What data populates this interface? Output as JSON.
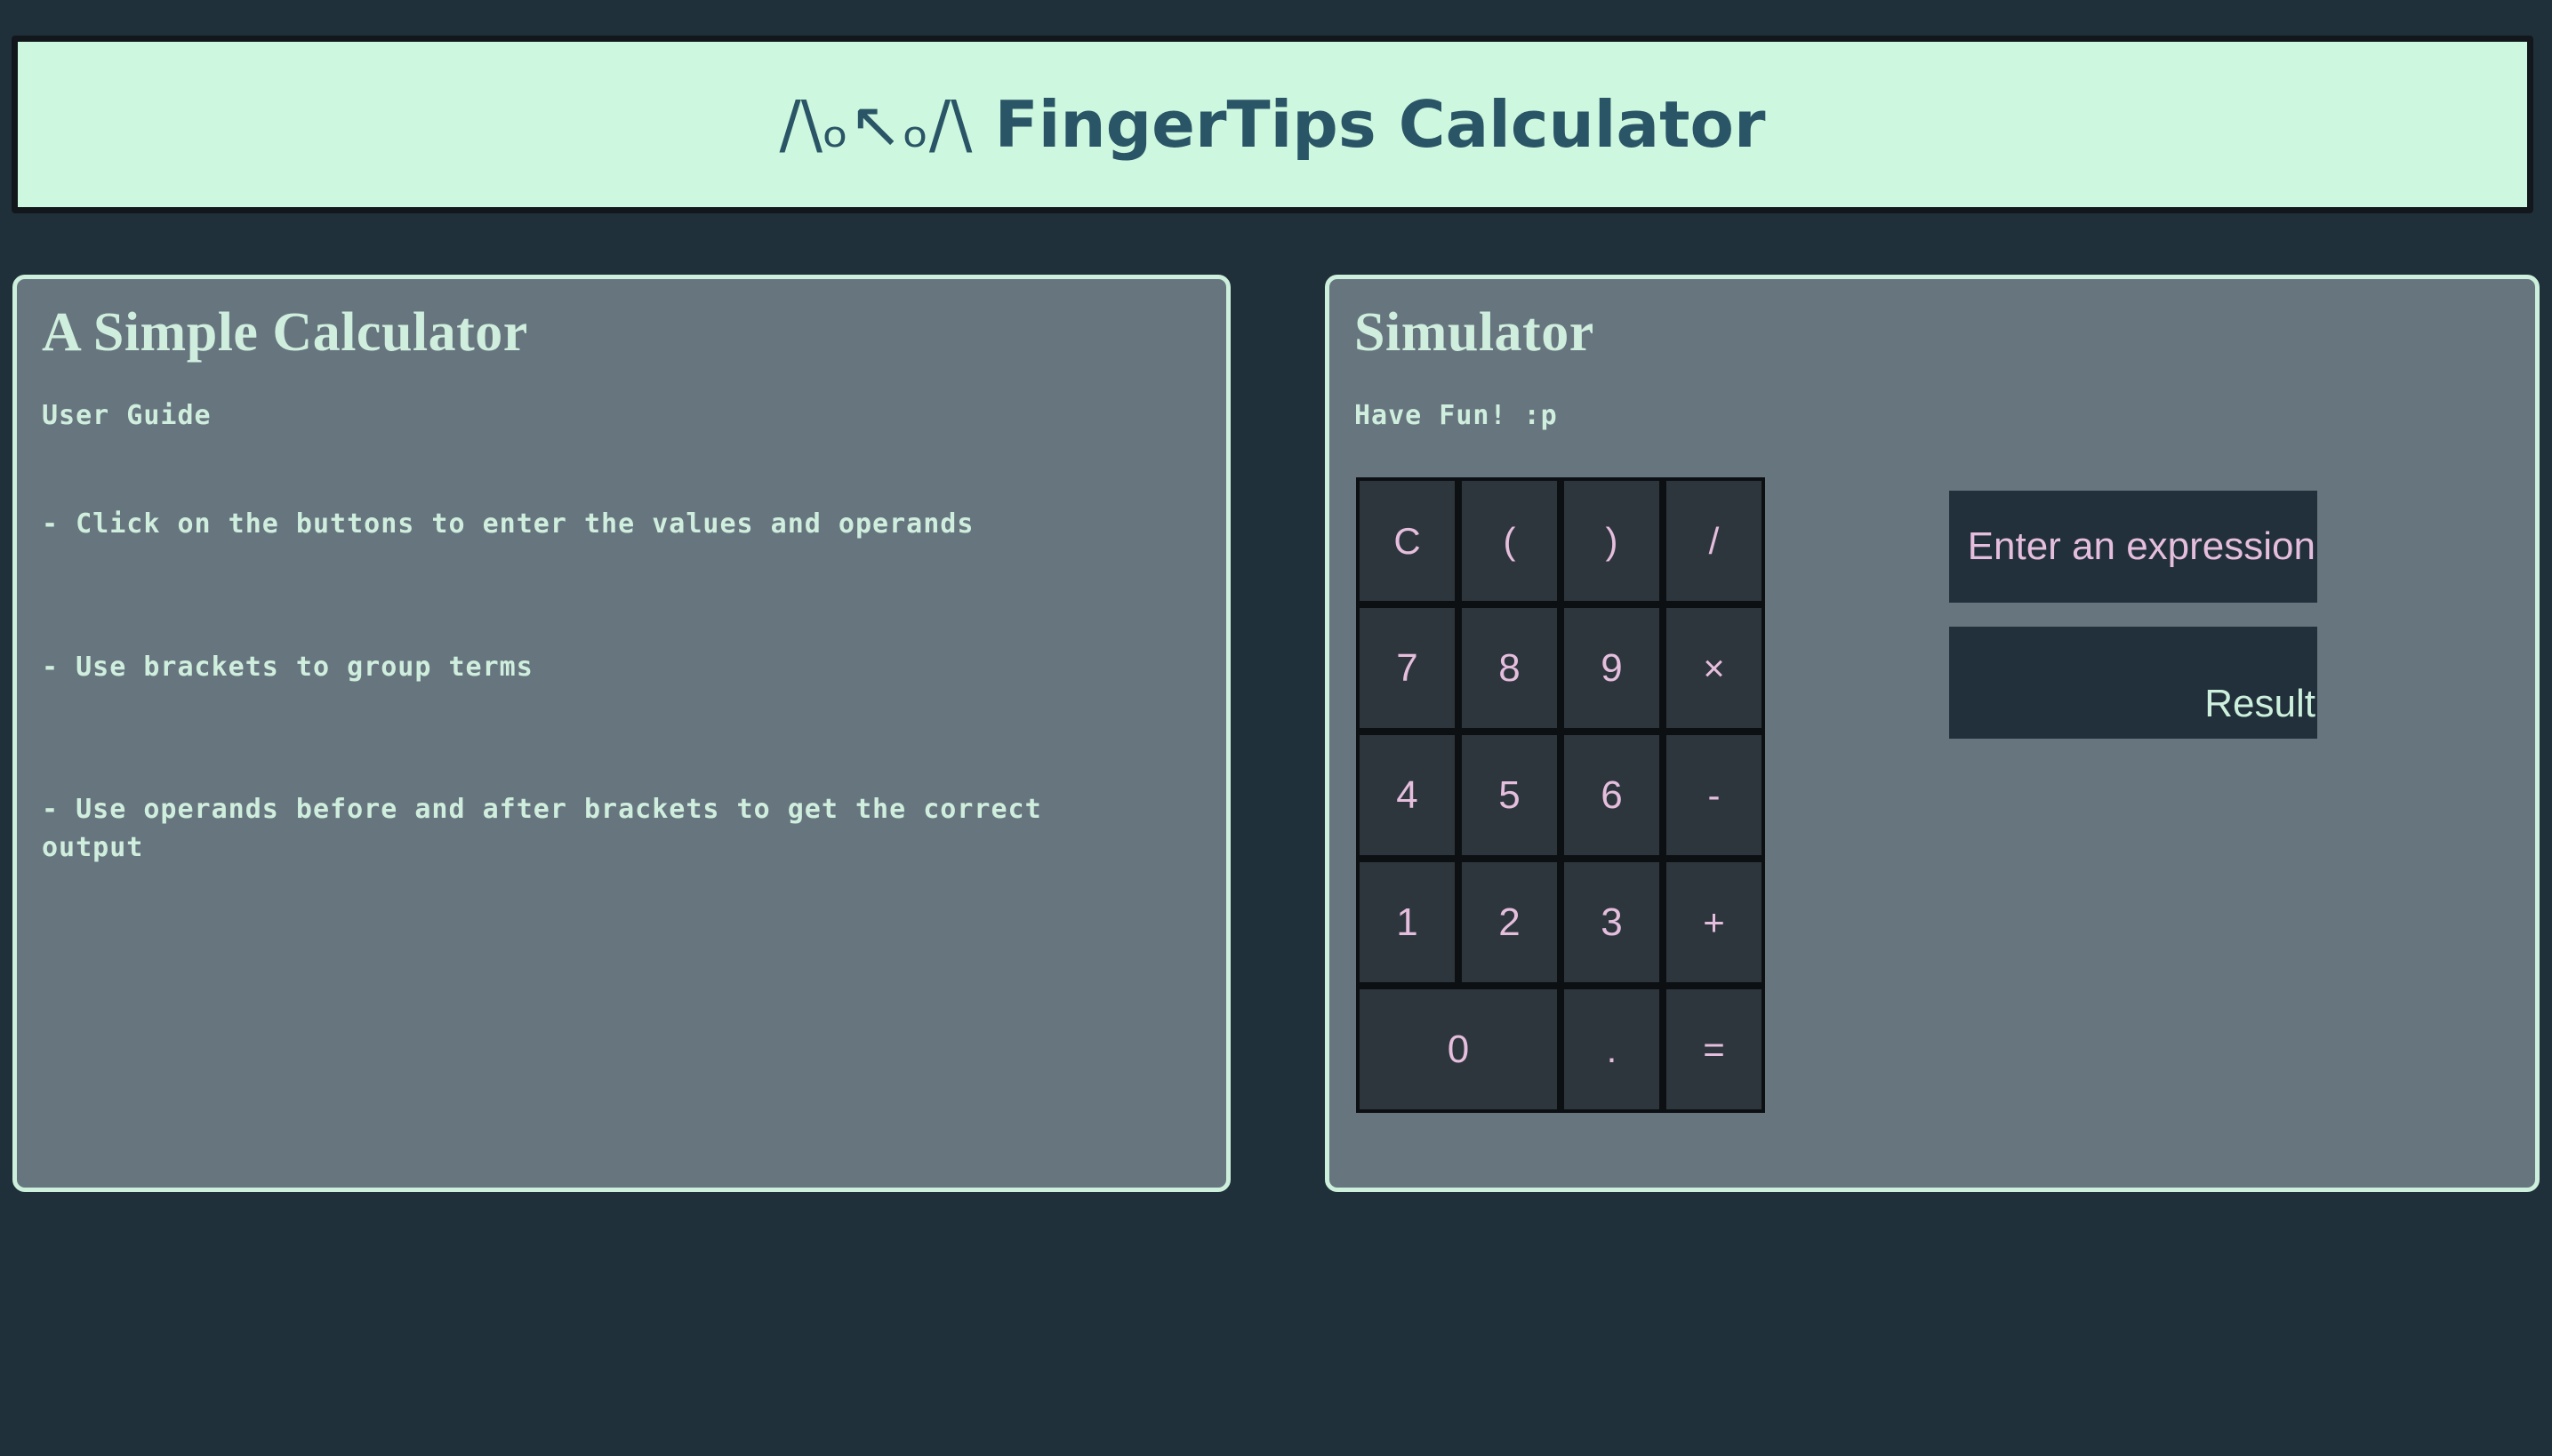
{
  "app": {
    "title_face": "/\\ₒ↖ₒ/\\",
    "title_text": " FingerTips Calculator",
    "bg_color": "#20303a",
    "banner_bg": "#cdf7de",
    "banner_border": "#12171c",
    "panel_bg": "#67757f",
    "panel_border": "#cdf0dd",
    "accent_pink": "#e5bede",
    "accent_mint": "#cdf0dd",
    "key_bg": "#2e363d"
  },
  "guide_panel": {
    "heading": "A Simple Calculator",
    "subheading": "User Guide",
    "items": [
      "- Click on the buttons to enter the values and operands",
      "- Use brackets to group terms",
      "- Use operands before and after brackets to get the correct output"
    ]
  },
  "simulator_panel": {
    "heading": "Simulator",
    "subheading": "Have Fun! :p",
    "keypad": {
      "rows": [
        [
          {
            "label": "C",
            "name": "key-clear",
            "kind": "op"
          },
          {
            "label": "(",
            "name": "key-open-paren",
            "kind": "op"
          },
          {
            "label": ")",
            "name": "key-close-paren",
            "kind": "op"
          },
          {
            "label": "/",
            "name": "key-divide",
            "kind": "op"
          }
        ],
        [
          {
            "label": "7",
            "name": "key-7",
            "kind": "num"
          },
          {
            "label": "8",
            "name": "key-8",
            "kind": "num"
          },
          {
            "label": "9",
            "name": "key-9",
            "kind": "num"
          },
          {
            "label": "×",
            "name": "key-multiply",
            "kind": "op"
          }
        ],
        [
          {
            "label": "4",
            "name": "key-4",
            "kind": "num"
          },
          {
            "label": "5",
            "name": "key-5",
            "kind": "num"
          },
          {
            "label": "6",
            "name": "key-6",
            "kind": "num"
          },
          {
            "label": "-",
            "name": "key-subtract",
            "kind": "op"
          }
        ],
        [
          {
            "label": "1",
            "name": "key-1",
            "kind": "num"
          },
          {
            "label": "2",
            "name": "key-2",
            "kind": "num"
          },
          {
            "label": "3",
            "name": "key-3",
            "kind": "num"
          },
          {
            "label": "+",
            "name": "key-add",
            "kind": "op"
          }
        ],
        [
          {
            "label": "0",
            "name": "key-0",
            "kind": "num",
            "wide": true
          },
          {
            "label": ".",
            "name": "key-decimal",
            "kind": "op"
          },
          {
            "label": "=",
            "name": "key-equals",
            "kind": "op"
          }
        ]
      ]
    },
    "display": {
      "expression_value": "Enter an expression",
      "expression_placeholder": "Enter an expression",
      "result_value": "Result",
      "result_placeholder": "Result"
    }
  }
}
